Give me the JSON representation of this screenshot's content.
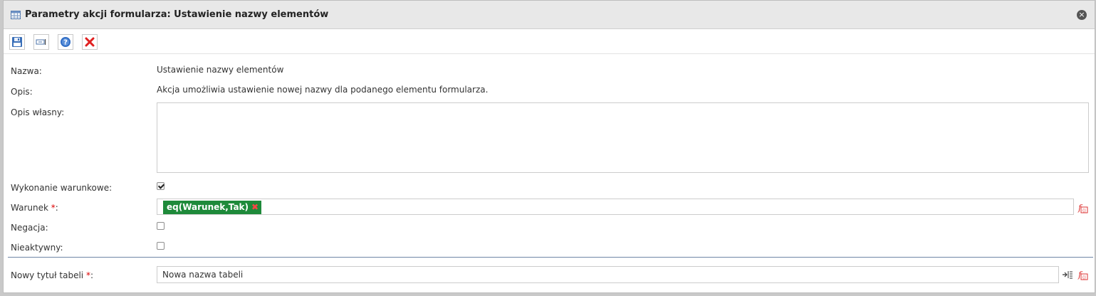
{
  "window": {
    "title": "Parametry akcji formularza: Ustawienie nazwy elementów",
    "close_glyph": "×"
  },
  "toolbar": {
    "buttons": [
      {
        "name": "save-icon"
      },
      {
        "name": "field-icon"
      },
      {
        "name": "help-icon"
      },
      {
        "name": "delete-icon"
      }
    ]
  },
  "form": {
    "name_label": "Nazwa:",
    "name_value": "Ustawienie nazwy elementów",
    "desc_label": "Opis:",
    "desc_value": "Akcja umożliwia ustawienie nowej nazwy dla podanego elementu formularza.",
    "own_desc_label": "Opis własny:",
    "own_desc_value": "",
    "conditional_label": "Wykonanie warunkowe:",
    "conditional_checked": true,
    "condition_label": "Warunek",
    "required_mark": "*",
    "colon": ":",
    "condition_tag": "eq(Warunek,Tak)",
    "condition_tag_remove": "✖",
    "negation_label": "Negacja:",
    "negation_checked": false,
    "inactive_label": "Nieaktywny:",
    "inactive_checked": false,
    "table_title_label": "Nowy tytuł tabeli",
    "table_title_value": "Nowa nazwa tabeli"
  },
  "colors": {
    "tag_bg": "#1e8a3a",
    "required": "#dd0000",
    "divider": "#6f86a6"
  }
}
